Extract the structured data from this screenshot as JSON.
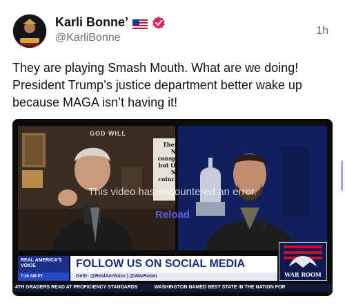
{
  "author": {
    "display_name": "Karli Bonne’",
    "handle": "@KarliBonne",
    "flag_icon": "us-flag-icon",
    "verified_icon": "verified-badge-icon",
    "avatar_icon": "avatar-icon"
  },
  "timestamp": "1h",
  "post": {
    "text": "They are playing Smash Mouth. What are we doing! President Trump’s justice department better wake up because MAGA isn’t having it!"
  },
  "media": {
    "error_message": "This video has encountered an error.",
    "reload_label": "Reload",
    "wall_sign": "GOD WILL",
    "on_screen_text": "There NO conspir but the NO coincid",
    "network_logo": "REAL AMERICA'S VOICE",
    "time_strip": "7:26 AM PT",
    "banner": "FOLLOW US ON SOCIAL MEDIA",
    "social_handles": "Gettr: @RealAmVoice | @WarRoom",
    "show_logo": "WAR ROOM",
    "ticker": [
      "4TH GRADERS READ AT PROFICIENCY STANDARDS",
      "WASHINGTON NAMED BEST STATE IN THE NATION FOR"
    ]
  },
  "colors": {
    "accent": "#e0245e",
    "link": "#5a5cf0",
    "banner_text": "#1a2a7c"
  }
}
